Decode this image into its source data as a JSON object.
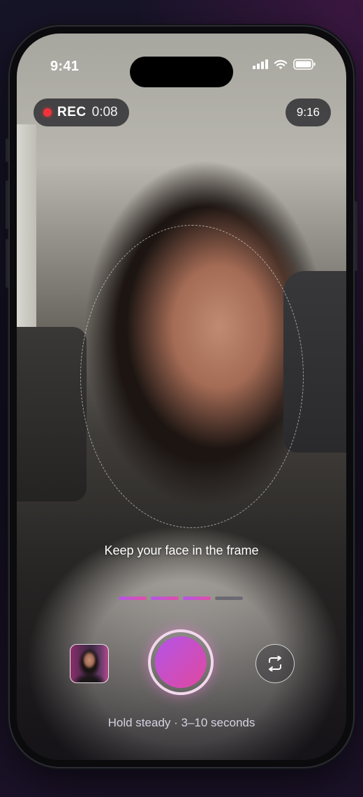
{
  "status_bar": {
    "time": "9:41"
  },
  "recording": {
    "label": "REC",
    "elapsed": "0:08"
  },
  "aspect_ratio": {
    "label": "9:16"
  },
  "guide": {
    "hint": "Keep your face in the frame"
  },
  "progress": {
    "segments_total": 4,
    "segments_filled": 3,
    "colors": {
      "filled_start": "#b357e6",
      "filled_end": "#e14fa5",
      "empty": "#6b6a73"
    }
  },
  "controls": {
    "gallery_icon": "gallery-thumbnail",
    "shutter_icon": "record-shutter",
    "flip_icon": "flip-camera-icon"
  },
  "footer": {
    "instruction": "Hold steady · 3–10 seconds"
  },
  "colors": {
    "rec_dot": "#f0333b",
    "accent_start": "#b454e8",
    "accent_end": "#e0489e"
  }
}
